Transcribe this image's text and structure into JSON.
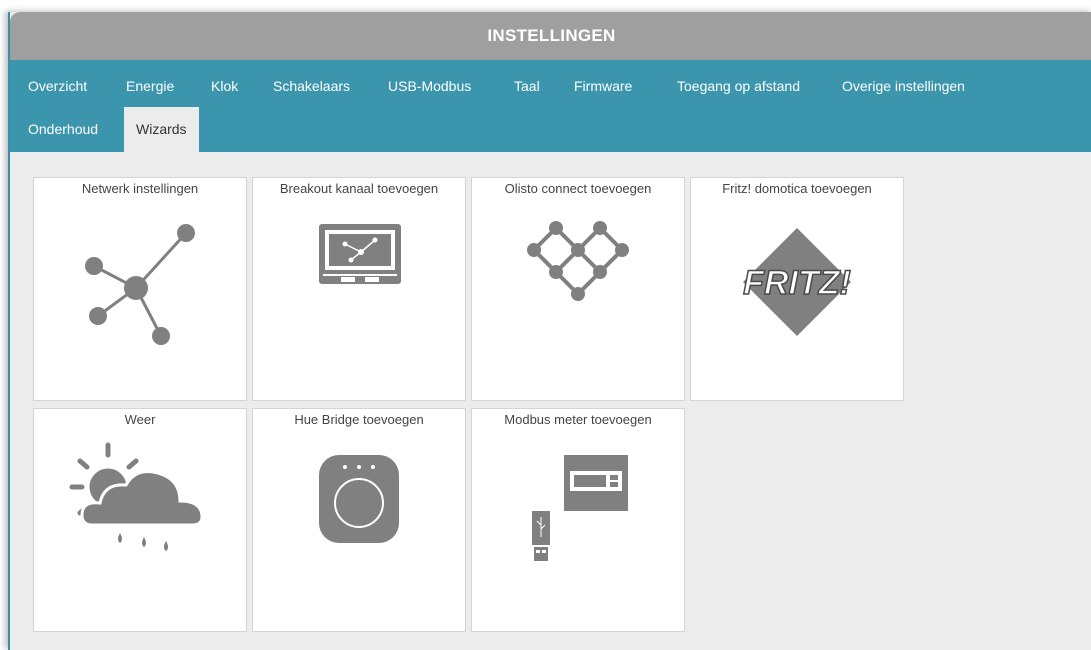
{
  "window": {
    "title": "INSTELLINGEN"
  },
  "tabs": [
    {
      "label": "Overzicht"
    },
    {
      "label": "Energie"
    },
    {
      "label": "Klok"
    },
    {
      "label": "Schakelaars"
    },
    {
      "label": "USB-Modbus"
    },
    {
      "label": "Taal"
    },
    {
      "label": "Firmware"
    },
    {
      "label": "Toegang op afstand"
    },
    {
      "label": "Overige instellingen"
    },
    {
      "label": "Onderhoud"
    },
    {
      "label": "Wizards",
      "active": true
    }
  ],
  "cards": [
    {
      "title": "Netwerk instellingen",
      "icon": "network-icon"
    },
    {
      "title": "Breakout kanaal toevoegen",
      "icon": "breakout-icon"
    },
    {
      "title": "Olisto connect toevoegen",
      "icon": "olisto-icon"
    },
    {
      "title": "Fritz! domotica toevoegen",
      "icon": "fritz-logo",
      "logo_text": "FRITZ!"
    },
    {
      "title": "Weer",
      "icon": "weather-icon"
    },
    {
      "title": "Hue Bridge toevoegen",
      "icon": "hue-bridge-icon"
    },
    {
      "title": "Modbus meter toevoegen",
      "icon": "modbus-meter-icon"
    }
  ],
  "colors": {
    "tabbar": "#3a95ad",
    "titlebar": "#9f9f9f",
    "icon": "#808080",
    "background": "#ececec"
  }
}
